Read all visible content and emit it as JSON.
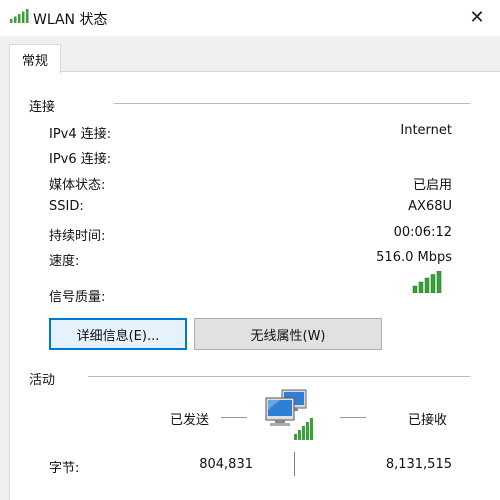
{
  "window": {
    "title": "WLAN 状态",
    "close_glyph": "✕"
  },
  "tabs": [
    {
      "label": "常规",
      "selected": true
    }
  ],
  "connection": {
    "group_label": "连接",
    "rows": [
      {
        "label": "IPv4 连接:",
        "value": "Internet"
      },
      {
        "label": "IPv6 连接:",
        "value": ""
      },
      {
        "label": "媒体状态:",
        "value": "已启用"
      },
      {
        "label": "SSID:",
        "value": "AX68U"
      },
      {
        "label": "持续时间:",
        "value": "00:06:12"
      },
      {
        "label": "速度:",
        "value": "516.0 Mbps"
      }
    ],
    "signal_quality_label": "信号质量:",
    "signal_bars_filled": 5,
    "signal_bars_total": 5
  },
  "buttons": {
    "details_label": "详细信息(E)...",
    "wireless_props_label": "无线属性(W)"
  },
  "activity": {
    "group_label": "活动",
    "sent_label": "已发送",
    "received_label": "已接收",
    "bytes_label": "字节:",
    "bytes_sent": "804,831",
    "bytes_received": "8,131,515"
  },
  "colors": {
    "signal_green": "#3aa13a",
    "accent_blue": "#0078d7",
    "monitor_blue": "#2f7fd6"
  },
  "icons": {
    "title": "wifi-signal-icon",
    "network": "network-computers-icon"
  }
}
